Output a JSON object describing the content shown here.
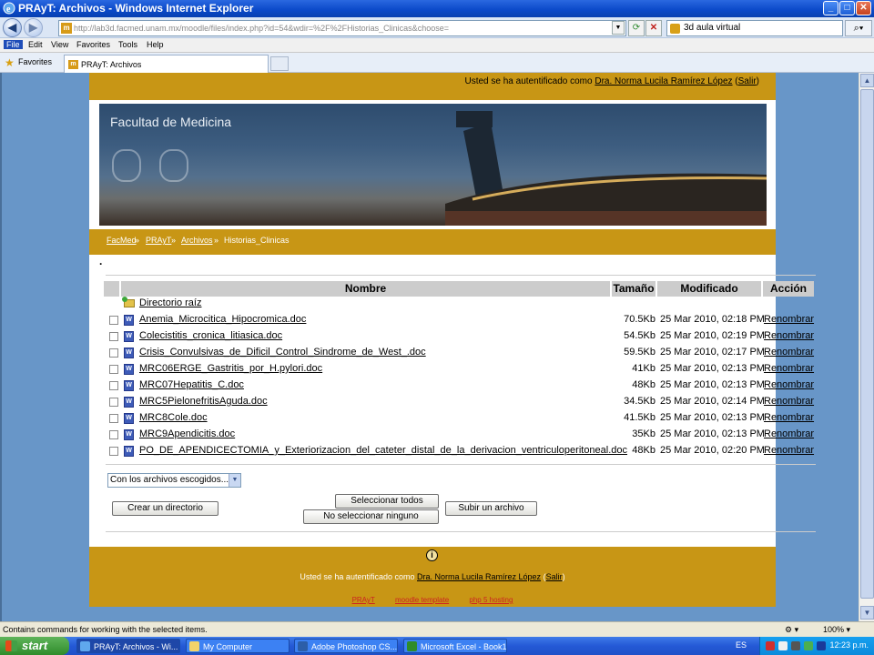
{
  "window": {
    "title": "PRAyT: Archivos - Windows Internet Explorer"
  },
  "addressbar": {
    "url": "http://lab3d.facmed.unam.mx/moodle/files/index.php?id=54&wdir=%2F%2FHistorias_Clinicas&choose=",
    "search_text": "3d aula virtual"
  },
  "menu": [
    "File",
    "Edit",
    "View",
    "Favorites",
    "Tools",
    "Help"
  ],
  "favorites_label": "Favorites",
  "tab_title": "PRAyT: Archivos",
  "header": {
    "login_prefix": "Usted se ha autentificado como",
    "user": "Dra. Norma Lucila Ramírez López",
    "logout": "Salir"
  },
  "banner_title": "Facultad de Medicina",
  "breadcrumb": [
    "FacMed",
    "PRAyT",
    "Archivos",
    "Historias_Clinicas"
  ],
  "breadcrumb_sep": "»",
  "dot": ".",
  "table": {
    "headers": [
      "Nombre",
      "Tamaño",
      "Modificado",
      "Acción"
    ],
    "parent_dir": "Directorio raíz",
    "action_label": "Renombrar",
    "files": [
      {
        "name": "Anemia_Microcitica_Hipocromica.doc",
        "size": "70.5Kb",
        "modified": "25 Mar 2010, 02:18 PM"
      },
      {
        "name": "Colecistitis_cronica_litiasica.doc",
        "size": "54.5Kb",
        "modified": "25 Mar 2010, 02:19 PM"
      },
      {
        "name": "Crisis_Convulsivas_de_Dificil_Control_Sindrome_de_West_.doc",
        "size": "59.5Kb",
        "modified": "25 Mar 2010, 02:17 PM"
      },
      {
        "name": "MRC06ERGE_Gastritis_por_H.pylori.doc",
        "size": "41Kb",
        "modified": "25 Mar 2010, 02:13 PM"
      },
      {
        "name": "MRC07Hepatitis_C.doc",
        "size": "48Kb",
        "modified": "25 Mar 2010, 02:13 PM"
      },
      {
        "name": "MRC5PielonefritisAguda.doc",
        "size": "34.5Kb",
        "modified": "25 Mar 2010, 02:14 PM"
      },
      {
        "name": "MRC8Cole.doc",
        "size": "41.5Kb",
        "modified": "25 Mar 2010, 02:13 PM"
      },
      {
        "name": "MRC9Apendicitis.doc",
        "size": "35Kb",
        "modified": "25 Mar 2010, 02:13 PM"
      },
      {
        "name": "PO_DE_APENDICECTOMIA_y_Exteriorizacion_del_cateter_distal_de_la_derivacion_ventriculoperitoneal.doc",
        "size": "48Kb",
        "modified": "25 Mar 2010, 02:20 PM"
      }
    ]
  },
  "select_label": "Con los archivos escogidos...",
  "buttons": {
    "create_dir": "Crear un directorio",
    "select_all": "Seleccionar todos",
    "select_none": "No seleccionar ninguno",
    "upload": "Subir un archivo"
  },
  "footer": {
    "info_icon": "i",
    "login_prefix": "Usted se ha autentificado como",
    "user": "Dra. Norma Lucila Ramírez López",
    "logout": "Salir",
    "links": [
      "PRAyT",
      "moodle template",
      "php 5 hosting"
    ]
  },
  "statusbar": {
    "message": "Contains commands for working with the selected items.",
    "zoom": "100%"
  },
  "taskbar": {
    "start": "start",
    "tasks": [
      "PRAyT: Archivos - Wi...",
      "My Computer",
      "Adobe Photoshop CS...",
      "Microsoft Excel - Book1"
    ],
    "lang": "ES",
    "clock": "12:23 p.m."
  },
  "colors": {
    "accent_gold": "#c89615",
    "page_bg": "#6896c8",
    "titlebar": "#0a48c8"
  }
}
